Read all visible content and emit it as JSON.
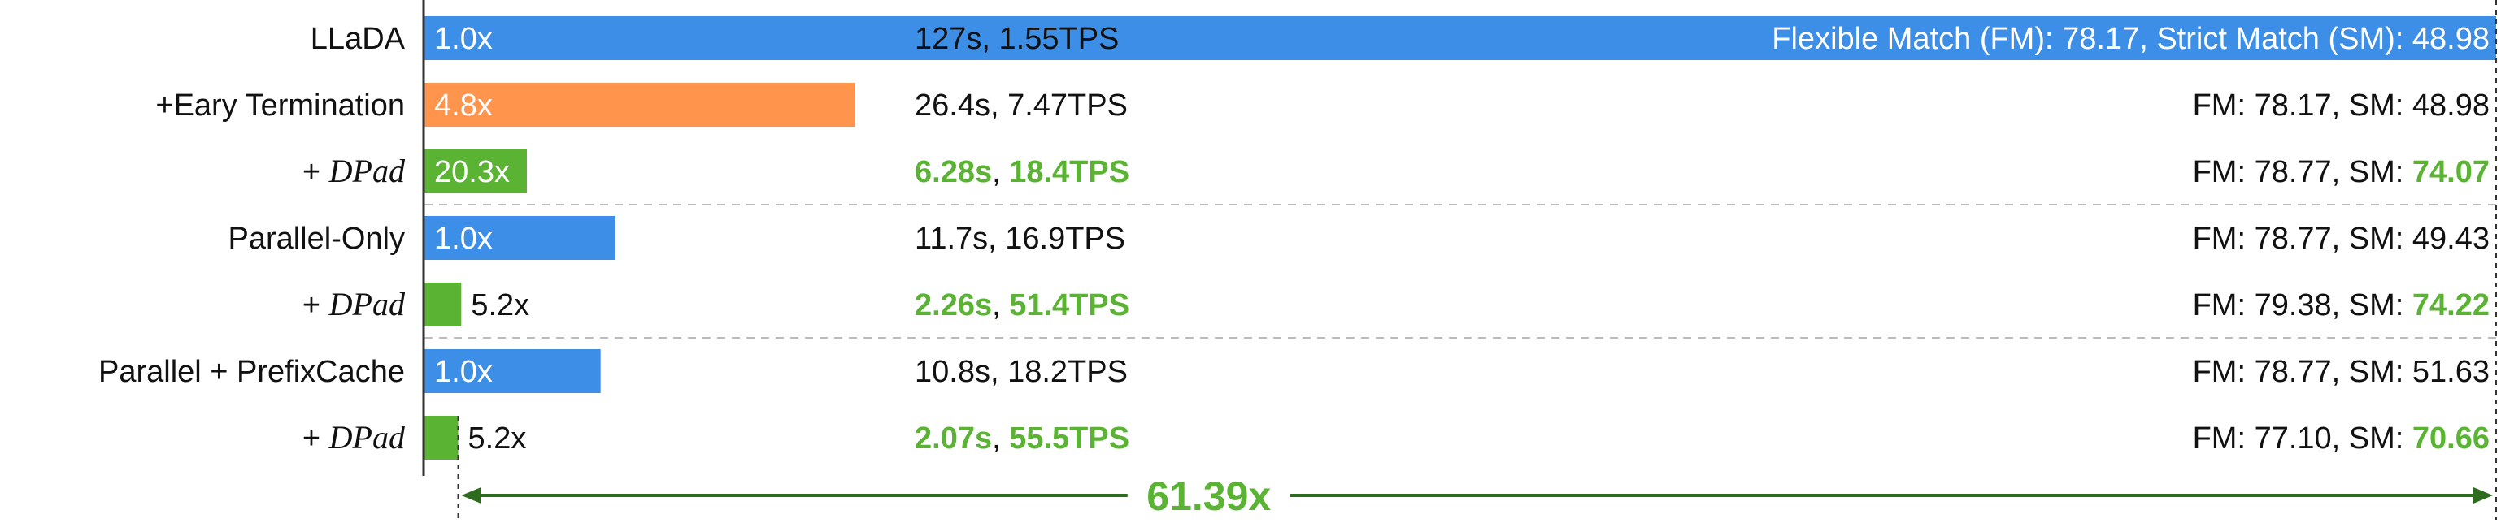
{
  "chart_data": {
    "type": "bar",
    "orientation": "horizontal",
    "colors": {
      "baseline": "#3d8ee6",
      "early_termination": "#ff944d",
      "dpad": "#5ab333",
      "highlight_text": "#5ab333",
      "arrow": "#2d6b1e"
    },
    "rows": [
      {
        "label": "LLaDA",
        "label_prefix": "",
        "label_italic": "",
        "value": 127,
        "value_label": "1.0x",
        "color_key": "baseline",
        "time": "127s",
        "tps": "1.55TPS",
        "time_hl": false,
        "tps_hl": false,
        "fm_label": "Flexible Match (FM): ",
        "fm": "78.17",
        "sm_label": ", Strict Match (SM): ",
        "sm": "48.98",
        "sm_hl": false
      },
      {
        "label": "+Eary Termination",
        "label_prefix": "",
        "label_italic": "",
        "value": 26.4,
        "value_label": "4.8x",
        "color_key": "early_termination",
        "time": "26.4s",
        "tps": "7.47TPS",
        "time_hl": false,
        "tps_hl": false,
        "fm_label": "FM: ",
        "fm": "78.17",
        "sm_label": ", SM: ",
        "sm": "48.98",
        "sm_hl": false
      },
      {
        "label": "",
        "label_prefix": "+ ",
        "label_italic": "DPad",
        "value": 6.28,
        "value_label": "20.3x",
        "color_key": "dpad",
        "time": "6.28s",
        "tps": "18.4TPS",
        "time_hl": true,
        "tps_hl": true,
        "fm_label": "FM: ",
        "fm": "78.77",
        "sm_label": ", SM: ",
        "sm": "74.07",
        "sm_hl": true
      },
      {
        "label": "Parallel-Only",
        "label_prefix": "",
        "label_italic": "",
        "value": 11.7,
        "value_label": "1.0x",
        "color_key": "baseline",
        "time": "11.7s",
        "tps": "16.9TPS",
        "time_hl": false,
        "tps_hl": false,
        "fm_label": "FM: ",
        "fm": "78.77",
        "sm_label": ", SM: ",
        "sm": "49.43",
        "sm_hl": false
      },
      {
        "label": "",
        "label_prefix": "+ ",
        "label_italic": "DPad",
        "value": 2.26,
        "value_label": "5.2x",
        "color_key": "dpad",
        "time": "2.26s",
        "tps": "51.4TPS",
        "time_hl": true,
        "tps_hl": true,
        "fm_label": "FM: ",
        "fm": "79.38",
        "sm_label": ", SM: ",
        "sm": "74.22",
        "sm_hl": true
      },
      {
        "label": "Parallel + PrefixCache",
        "label_prefix": "",
        "label_italic": "",
        "value": 10.8,
        "value_label": "1.0x",
        "color_key": "baseline",
        "time": "10.8s",
        "tps": "18.2TPS",
        "time_hl": false,
        "tps_hl": false,
        "fm_label": "FM: ",
        "fm": "78.77",
        "sm_label": ", SM: ",
        "sm": "51.63",
        "sm_hl": false
      },
      {
        "label": "",
        "label_prefix": "+ ",
        "label_italic": "DPad",
        "value": 2.07,
        "value_label": "5.2x",
        "color_key": "dpad",
        "time": "2.07s",
        "tps": "55.5TPS",
        "time_hl": true,
        "tps_hl": true,
        "fm_label": "FM: ",
        "fm": "77.10",
        "sm_label": ", SM: ",
        "sm": "70.66",
        "sm_hl": true
      }
    ],
    "group_separators_after_rows": [
      2,
      4
    ],
    "overall_speedup": "61.39x",
    "xlim": [
      0,
      127
    ],
    "grid": false,
    "legend": "none"
  }
}
